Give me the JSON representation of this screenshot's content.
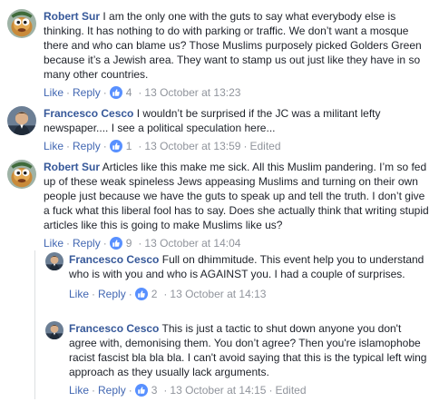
{
  "colors": {
    "link": "#4267b2",
    "author": "#365899",
    "meta": "#90949c",
    "like_badge": "#5890ff"
  },
  "ui": {
    "like_label": "Like",
    "reply_label": "Reply",
    "separator": "·"
  },
  "comments": [
    {
      "author": "Robert Sur",
      "text": "I am the only one with the guts to say what everybody else is thinking. It has nothing to do with parking or traffic. We don’t want a mosque there and who can blame us? Those Muslims purposely picked Golders Green because it’s a Jewish area. They want to stamp us out just like they have in so many other countries.",
      "likes": "4",
      "timestamp": "13 October at 13:23",
      "edited": "",
      "avatar_icon": "cartoon-avatar-icon"
    },
    {
      "author": "Francesco Cesco",
      "text": "I wouldn’t be surprised if the JC was a militant lefty newspaper.... I see a political speculation here...",
      "likes": "1",
      "timestamp": "13 October at 13:59",
      "edited": "Edited",
      "avatar_icon": "profile-photo-icon"
    },
    {
      "author": "Robert Sur",
      "text": "Articles like this make me sick. All this Muslim pandering. I’m so fed up of these weak spineless Jews appeasing Muslims and turning on their own people just because we have the guts to speak up and tell the truth. I don’t give a fuck what this liberal fool has to say. Does she actually think that writing stupid articles like this is going to make Muslims like us?",
      "likes": "9",
      "timestamp": "13 October at 14:04",
      "edited": "",
      "avatar_icon": "cartoon-avatar-icon"
    },
    {
      "author": "Francesco Cesco",
      "text": "Full on dhimmitude. This event help you to understand who is with you and who is AGAINST you. I had a couple of surprises.",
      "likes": "2",
      "timestamp": "13 October at 14:13",
      "edited": "",
      "avatar_icon": "profile-photo-icon"
    },
    {
      "author": "Francesco Cesco",
      "text": "This is just a tactic to shut down anyone you don't agree with, demonising them. You don’t agree? Then you're islamophobe racist fascist bla bla bla. I can't avoid saying that this is the typical left wing approach as they usually lack arguments.",
      "likes": "3",
      "timestamp": "13 October at 14:15",
      "edited": "Edited",
      "avatar_icon": "profile-photo-icon"
    }
  ]
}
